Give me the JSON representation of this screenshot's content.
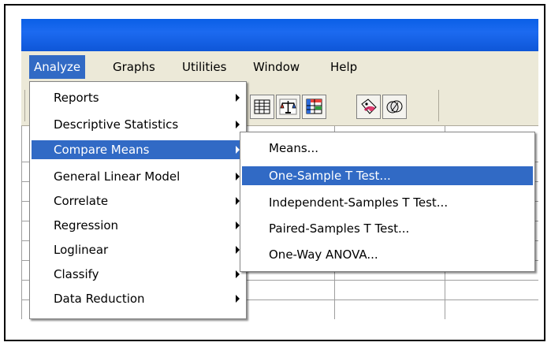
{
  "menubar": {
    "items": [
      {
        "label": "Analyze"
      },
      {
        "label": "Graphs"
      },
      {
        "label": "Utilities"
      },
      {
        "label": "Window"
      },
      {
        "label": "Help"
      }
    ]
  },
  "analyze_menu": {
    "items": [
      {
        "label": "Reports"
      },
      {
        "label": "Descriptive Statistics"
      },
      {
        "label": "Compare Means"
      },
      {
        "label": "General Linear Model"
      },
      {
        "label": "Correlate"
      },
      {
        "label": "Regression"
      },
      {
        "label": "Loglinear"
      },
      {
        "label": "Classify"
      },
      {
        "label": "Data Reduction"
      }
    ]
  },
  "compare_means_menu": {
    "items": [
      {
        "label": "Means..."
      },
      {
        "label": "One-Sample T Test..."
      },
      {
        "label": "Independent-Samples T Test..."
      },
      {
        "label": "Paired-Samples T Test..."
      },
      {
        "label": "One-Way ANOVA..."
      }
    ]
  },
  "toolbar": {
    "icons": [
      "table-icon",
      "scale-icon",
      "grid-select-icon",
      "tag-icon",
      "circles-icon"
    ]
  },
  "colors": {
    "highlight": "#316ac5",
    "titlebar": "#0a5fe6",
    "menu_bg": "#ece9d8"
  }
}
